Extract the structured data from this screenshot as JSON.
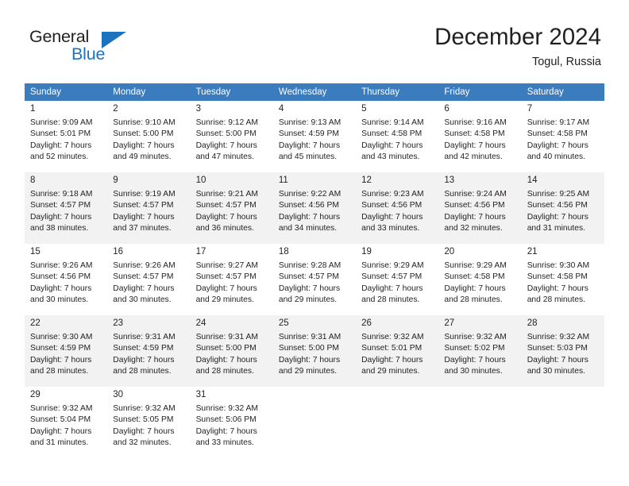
{
  "brand": {
    "name_part1": "General",
    "name_part2": "Blue",
    "logo_icon": "triangle-logo-icon",
    "accent_color": "#1b72bd"
  },
  "header": {
    "title": "December 2024",
    "location": "Togul, Russia"
  },
  "calendar": {
    "header_bg": "#3a7cbe",
    "weekdays": [
      "Sunday",
      "Monday",
      "Tuesday",
      "Wednesday",
      "Thursday",
      "Friday",
      "Saturday"
    ],
    "weeks": [
      [
        {
          "day": "1",
          "sunrise": "Sunrise: 9:09 AM",
          "sunset": "Sunset: 5:01 PM",
          "daylight_line1": "Daylight: 7 hours",
          "daylight_line2": "and 52 minutes."
        },
        {
          "day": "2",
          "sunrise": "Sunrise: 9:10 AM",
          "sunset": "Sunset: 5:00 PM",
          "daylight_line1": "Daylight: 7 hours",
          "daylight_line2": "and 49 minutes."
        },
        {
          "day": "3",
          "sunrise": "Sunrise: 9:12 AM",
          "sunset": "Sunset: 5:00 PM",
          "daylight_line1": "Daylight: 7 hours",
          "daylight_line2": "and 47 minutes."
        },
        {
          "day": "4",
          "sunrise": "Sunrise: 9:13 AM",
          "sunset": "Sunset: 4:59 PM",
          "daylight_line1": "Daylight: 7 hours",
          "daylight_line2": "and 45 minutes."
        },
        {
          "day": "5",
          "sunrise": "Sunrise: 9:14 AM",
          "sunset": "Sunset: 4:58 PM",
          "daylight_line1": "Daylight: 7 hours",
          "daylight_line2": "and 43 minutes."
        },
        {
          "day": "6",
          "sunrise": "Sunrise: 9:16 AM",
          "sunset": "Sunset: 4:58 PM",
          "daylight_line1": "Daylight: 7 hours",
          "daylight_line2": "and 42 minutes."
        },
        {
          "day": "7",
          "sunrise": "Sunrise: 9:17 AM",
          "sunset": "Sunset: 4:58 PM",
          "daylight_line1": "Daylight: 7 hours",
          "daylight_line2": "and 40 minutes."
        }
      ],
      [
        {
          "day": "8",
          "sunrise": "Sunrise: 9:18 AM",
          "sunset": "Sunset: 4:57 PM",
          "daylight_line1": "Daylight: 7 hours",
          "daylight_line2": "and 38 minutes."
        },
        {
          "day": "9",
          "sunrise": "Sunrise: 9:19 AM",
          "sunset": "Sunset: 4:57 PM",
          "daylight_line1": "Daylight: 7 hours",
          "daylight_line2": "and 37 minutes."
        },
        {
          "day": "10",
          "sunrise": "Sunrise: 9:21 AM",
          "sunset": "Sunset: 4:57 PM",
          "daylight_line1": "Daylight: 7 hours",
          "daylight_line2": "and 36 minutes."
        },
        {
          "day": "11",
          "sunrise": "Sunrise: 9:22 AM",
          "sunset": "Sunset: 4:56 PM",
          "daylight_line1": "Daylight: 7 hours",
          "daylight_line2": "and 34 minutes."
        },
        {
          "day": "12",
          "sunrise": "Sunrise: 9:23 AM",
          "sunset": "Sunset: 4:56 PM",
          "daylight_line1": "Daylight: 7 hours",
          "daylight_line2": "and 33 minutes."
        },
        {
          "day": "13",
          "sunrise": "Sunrise: 9:24 AM",
          "sunset": "Sunset: 4:56 PM",
          "daylight_line1": "Daylight: 7 hours",
          "daylight_line2": "and 32 minutes."
        },
        {
          "day": "14",
          "sunrise": "Sunrise: 9:25 AM",
          "sunset": "Sunset: 4:56 PM",
          "daylight_line1": "Daylight: 7 hours",
          "daylight_line2": "and 31 minutes."
        }
      ],
      [
        {
          "day": "15",
          "sunrise": "Sunrise: 9:26 AM",
          "sunset": "Sunset: 4:56 PM",
          "daylight_line1": "Daylight: 7 hours",
          "daylight_line2": "and 30 minutes."
        },
        {
          "day": "16",
          "sunrise": "Sunrise: 9:26 AM",
          "sunset": "Sunset: 4:57 PM",
          "daylight_line1": "Daylight: 7 hours",
          "daylight_line2": "and 30 minutes."
        },
        {
          "day": "17",
          "sunrise": "Sunrise: 9:27 AM",
          "sunset": "Sunset: 4:57 PM",
          "daylight_line1": "Daylight: 7 hours",
          "daylight_line2": "and 29 minutes."
        },
        {
          "day": "18",
          "sunrise": "Sunrise: 9:28 AM",
          "sunset": "Sunset: 4:57 PM",
          "daylight_line1": "Daylight: 7 hours",
          "daylight_line2": "and 29 minutes."
        },
        {
          "day": "19",
          "sunrise": "Sunrise: 9:29 AM",
          "sunset": "Sunset: 4:57 PM",
          "daylight_line1": "Daylight: 7 hours",
          "daylight_line2": "and 28 minutes."
        },
        {
          "day": "20",
          "sunrise": "Sunrise: 9:29 AM",
          "sunset": "Sunset: 4:58 PM",
          "daylight_line1": "Daylight: 7 hours",
          "daylight_line2": "and 28 minutes."
        },
        {
          "day": "21",
          "sunrise": "Sunrise: 9:30 AM",
          "sunset": "Sunset: 4:58 PM",
          "daylight_line1": "Daylight: 7 hours",
          "daylight_line2": "and 28 minutes."
        }
      ],
      [
        {
          "day": "22",
          "sunrise": "Sunrise: 9:30 AM",
          "sunset": "Sunset: 4:59 PM",
          "daylight_line1": "Daylight: 7 hours",
          "daylight_line2": "and 28 minutes."
        },
        {
          "day": "23",
          "sunrise": "Sunrise: 9:31 AM",
          "sunset": "Sunset: 4:59 PM",
          "daylight_line1": "Daylight: 7 hours",
          "daylight_line2": "and 28 minutes."
        },
        {
          "day": "24",
          "sunrise": "Sunrise: 9:31 AM",
          "sunset": "Sunset: 5:00 PM",
          "daylight_line1": "Daylight: 7 hours",
          "daylight_line2": "and 28 minutes."
        },
        {
          "day": "25",
          "sunrise": "Sunrise: 9:31 AM",
          "sunset": "Sunset: 5:00 PM",
          "daylight_line1": "Daylight: 7 hours",
          "daylight_line2": "and 29 minutes."
        },
        {
          "day": "26",
          "sunrise": "Sunrise: 9:32 AM",
          "sunset": "Sunset: 5:01 PM",
          "daylight_line1": "Daylight: 7 hours",
          "daylight_line2": "and 29 minutes."
        },
        {
          "day": "27",
          "sunrise": "Sunrise: 9:32 AM",
          "sunset": "Sunset: 5:02 PM",
          "daylight_line1": "Daylight: 7 hours",
          "daylight_line2": "and 30 minutes."
        },
        {
          "day": "28",
          "sunrise": "Sunrise: 9:32 AM",
          "sunset": "Sunset: 5:03 PM",
          "daylight_line1": "Daylight: 7 hours",
          "daylight_line2": "and 30 minutes."
        }
      ],
      [
        {
          "day": "29",
          "sunrise": "Sunrise: 9:32 AM",
          "sunset": "Sunset: 5:04 PM",
          "daylight_line1": "Daylight: 7 hours",
          "daylight_line2": "and 31 minutes."
        },
        {
          "day": "30",
          "sunrise": "Sunrise: 9:32 AM",
          "sunset": "Sunset: 5:05 PM",
          "daylight_line1": "Daylight: 7 hours",
          "daylight_line2": "and 32 minutes."
        },
        {
          "day": "31",
          "sunrise": "Sunrise: 9:32 AM",
          "sunset": "Sunset: 5:06 PM",
          "daylight_line1": "Daylight: 7 hours",
          "daylight_line2": "and 33 minutes."
        },
        {
          "day": "",
          "sunrise": "",
          "sunset": "",
          "daylight_line1": "",
          "daylight_line2": ""
        },
        {
          "day": "",
          "sunrise": "",
          "sunset": "",
          "daylight_line1": "",
          "daylight_line2": ""
        },
        {
          "day": "",
          "sunrise": "",
          "sunset": "",
          "daylight_line1": "",
          "daylight_line2": ""
        },
        {
          "day": "",
          "sunrise": "",
          "sunset": "",
          "daylight_line1": "",
          "daylight_line2": ""
        }
      ]
    ]
  }
}
